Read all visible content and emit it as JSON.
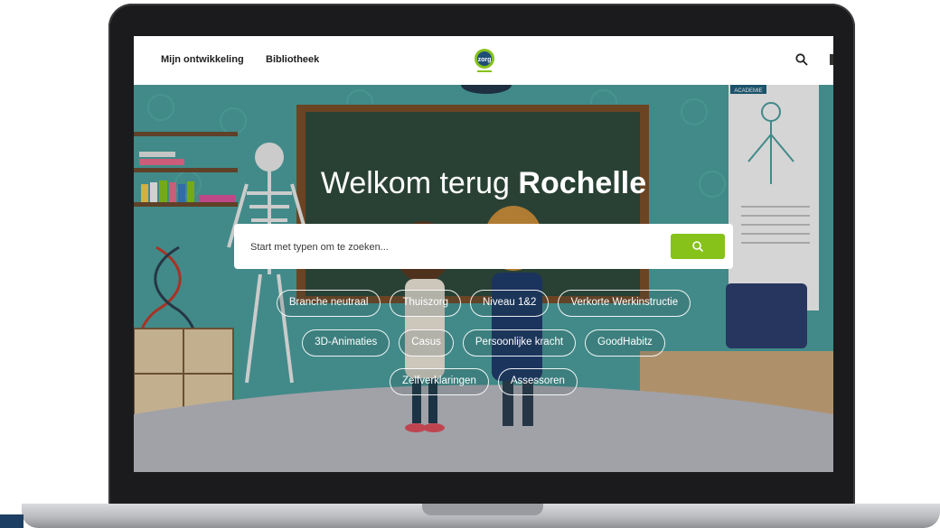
{
  "nav": {
    "links": [
      "Mijn ontwikkeling",
      "Bibliotheek"
    ],
    "logo_text": "zorg"
  },
  "hero": {
    "welcome": "Welkom terug",
    "name": "Rochelle",
    "board_sign": "ACADEMIE"
  },
  "search": {
    "placeholder": "Start met typen om te zoeken..."
  },
  "chips": [
    [
      "Branche neutraal",
      "Thuiszorg",
      "Niveau 1&2",
      "Verkorte Werkinstructie"
    ],
    [
      "3D-Animaties",
      "Casus",
      "Persoonlijke kracht",
      "GoodHabitz"
    ],
    [
      "Zelfverklaringen",
      "Assessoren"
    ]
  ],
  "colors": {
    "accent_green": "#86c21a",
    "hero_teal": "#4a9e9c",
    "chalkboard": "#2f4a3c"
  }
}
